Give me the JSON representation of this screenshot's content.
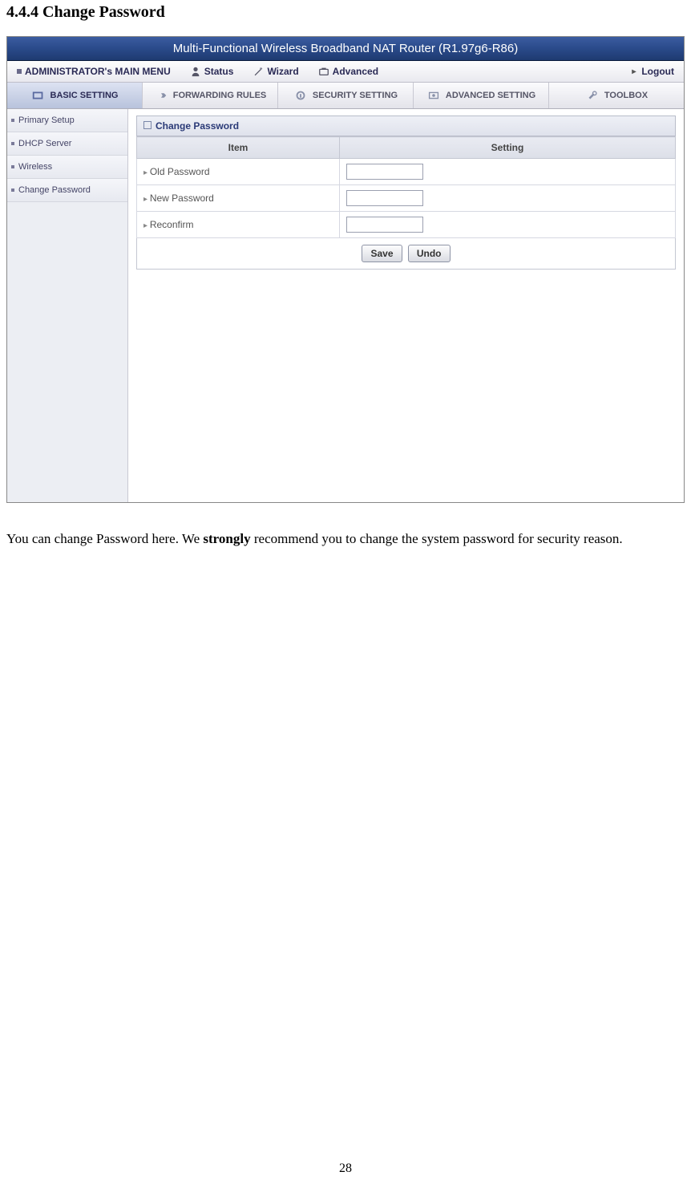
{
  "heading": "4.4.4 Change Password",
  "titlebar": "Multi-Functional Wireless Broadband NAT Router (R1.97g6-R86)",
  "topmenu": {
    "main": "ADMINISTRATOR's MAIN MENU",
    "status": "Status",
    "wizard": "Wizard",
    "advanced": "Advanced",
    "logout": "Logout"
  },
  "tabs": {
    "basic": "BASIC SETTING",
    "forwarding": "FORWARDING RULES",
    "security": "SECURITY SETTING",
    "advanced": "ADVANCED SETTING",
    "toolbox": "TOOLBOX"
  },
  "sidebar": {
    "items": [
      {
        "label": "Primary Setup"
      },
      {
        "label": "DHCP Server"
      },
      {
        "label": "Wireless"
      },
      {
        "label": "Change Password"
      }
    ]
  },
  "panel": {
    "title": "Change Password",
    "col_item": "Item",
    "col_setting": "Setting",
    "old": "Old Password",
    "new": "New Password",
    "reconfirm": "Reconfirm",
    "save": "Save",
    "undo": "Undo"
  },
  "bodytext": {
    "pre": "You can change Password here. We ",
    "strong": "strongly",
    "post": " recommend you to change the system password for security reason."
  },
  "pagenum": "28"
}
